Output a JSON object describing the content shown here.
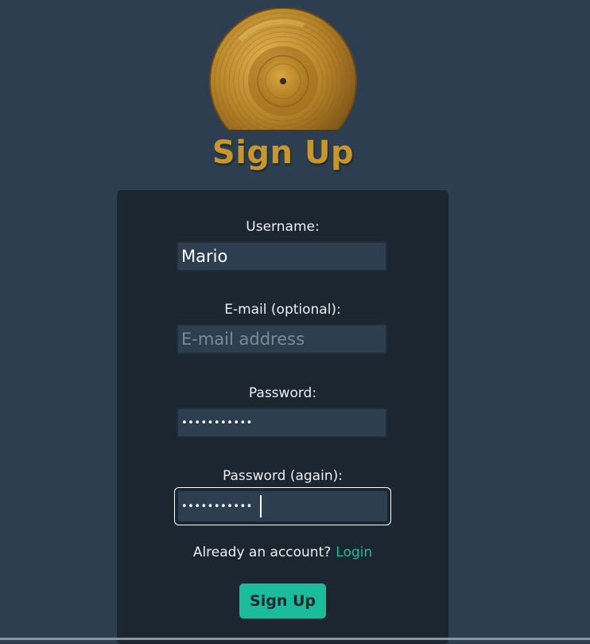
{
  "colors": {
    "background": "#2c3e50",
    "card": "#1b2631",
    "title": "#c7972a",
    "accent": "#1abc9c",
    "input_background": "#2c3e50"
  },
  "logo": {
    "icon": "gold-vinyl-record-icon"
  },
  "title": "Sign Up",
  "form": {
    "username": {
      "label": "Username:",
      "value": "Mario",
      "placeholder": ""
    },
    "email": {
      "label": "E-mail (optional):",
      "value": "",
      "placeholder": "E-mail address"
    },
    "password": {
      "label": "Password:",
      "value": "•••••••••••"
    },
    "password_again": {
      "label": "Password (again):",
      "value": "•••••••••••"
    },
    "login_prompt": "Already an account?",
    "login_link": "Login",
    "submit_label": "Sign Up"
  }
}
